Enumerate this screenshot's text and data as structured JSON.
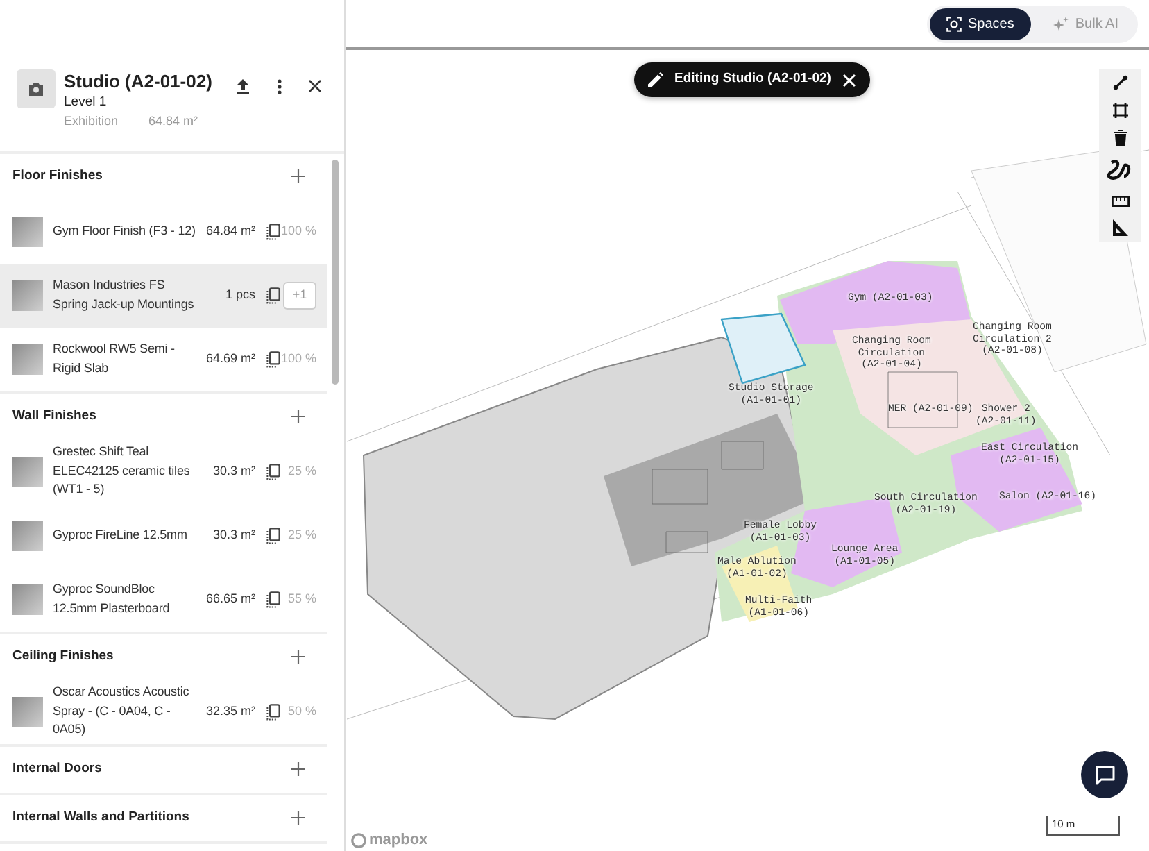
{
  "mode_toggle": [
    {
      "label": "Spaces",
      "selected": true
    },
    {
      "label": "Bulk AI",
      "selected": false
    }
  ],
  "space": {
    "title": "Studio (A2-01-02)",
    "level": "Level 1",
    "type": "Exhibition",
    "area": "64.84 m²"
  },
  "sections": [
    {
      "title": "Floor Finishes",
      "items": [
        {
          "name": "Gym Floor Finish (F3 - 12)",
          "quantity": "64.84 m²",
          "kind": "share",
          "value": "100 %",
          "selected": false
        },
        {
          "name": "Mason Industries FS Spring Jack-up Mountings",
          "quantity": "1 pcs",
          "kind": "increment",
          "value": "+1",
          "selected": true
        },
        {
          "name": "Rockwool RW5 Semi - Rigid Slab",
          "quantity": "64.69 m²",
          "kind": "share",
          "value": "100 %",
          "selected": false
        }
      ]
    },
    {
      "title": "Wall Finishes",
      "items": [
        {
          "name": "Grestec Shift Teal ELEC42125 ceramic tiles (WT1 - 5)",
          "quantity": "30.3 m²",
          "kind": "share",
          "value": "25 %",
          "selected": false
        },
        {
          "name": "Gyproc FireLine 12.5mm",
          "quantity": "30.3 m²",
          "kind": "share",
          "value": "25 %",
          "selected": false
        },
        {
          "name": "Gyproc SoundBloc 12.5mm Plasterboard",
          "quantity": "66.65 m²",
          "kind": "share",
          "value": "55 %",
          "selected": false
        }
      ]
    },
    {
      "title": "Ceiling Finishes",
      "items": [
        {
          "name": "Oscar Acoustics Acoustic Spray - (C - 0A04, C - 0A05)",
          "quantity": "32.35 m²",
          "kind": "share",
          "value": "50 %",
          "selected": false
        }
      ]
    },
    {
      "title": "Internal Doors"
    },
    {
      "title": "Internal Walls and Partitions"
    }
  ],
  "editing_banner": "Editing Studio (A2-01-02)",
  "rooms": [
    {
      "lines": [
        "Gym (A2-01-03)"
      ]
    },
    {
      "lines": [
        "Changing Room",
        "Circulation",
        "(A2-01-04)"
      ]
    },
    {
      "lines": [
        "Changing Room",
        "Circulation 2",
        "(A2-01-08)"
      ]
    },
    {
      "lines": [
        "Studio Storage",
        "(A1-01-01)"
      ]
    },
    {
      "lines": [
        "MER (A2-01-09)"
      ]
    },
    {
      "lines": [
        "Shower 2",
        "(A2-01-11)"
      ]
    },
    {
      "lines": [
        "East Circulation",
        "(A2-01-15)"
      ]
    },
    {
      "lines": [
        "South Circulation",
        "(A2-01-19)"
      ]
    },
    {
      "lines": [
        "Salon (A2-01-16)"
      ]
    },
    {
      "lines": [
        "Female Lobby",
        "(A1-01-03)"
      ]
    },
    {
      "lines": [
        "Male Ablution",
        "(A1-01-02)"
      ]
    },
    {
      "lines": [
        "Lounge Area",
        "(A1-01-05)"
      ]
    },
    {
      "lines": [
        "Multi-Faith",
        "(A1-01-06)"
      ]
    }
  ],
  "scale": "10 m",
  "map_logo": "mapbox"
}
